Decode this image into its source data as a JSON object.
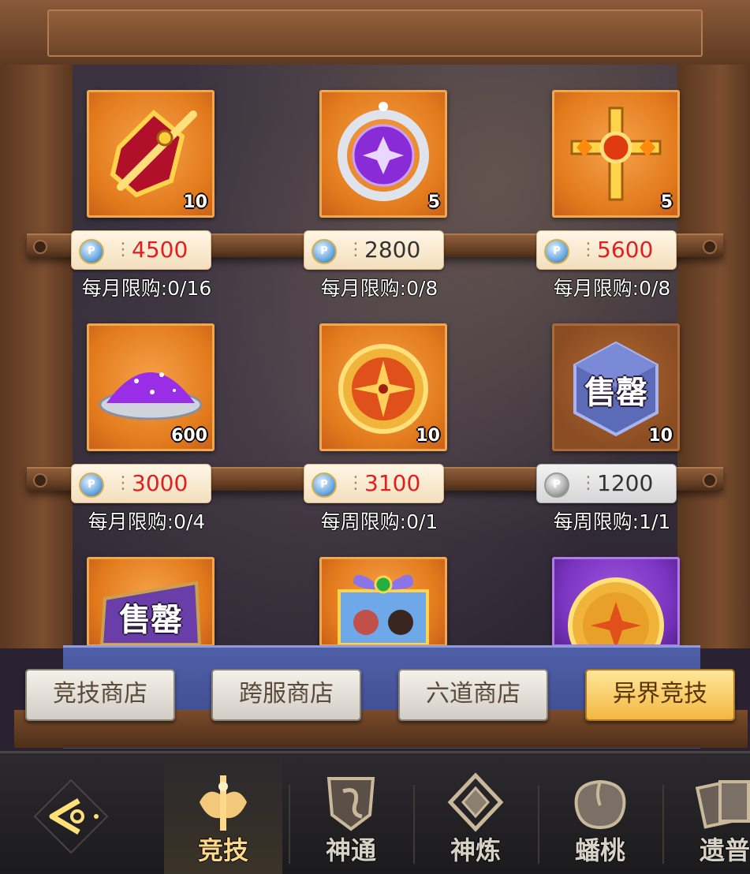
{
  "shop_items": [
    {
      "count": "10",
      "price": "4500",
      "limit": "每月限购:0/16",
      "price_style": "red",
      "box": "orange",
      "icon": "sword-shard-icon"
    },
    {
      "count": "5",
      "price": "2800",
      "limit": "每月限购:0/8",
      "price_style": "dark",
      "box": "orange",
      "icon": "purple-orb-icon"
    },
    {
      "count": "5",
      "price": "5600",
      "limit": "每月限购:0/8",
      "price_style": "red",
      "box": "orange",
      "icon": "golden-cross-icon"
    },
    {
      "count": "600",
      "price": "3000",
      "limit": "每月限购:0/4",
      "price_style": "red",
      "box": "orange",
      "icon": "purple-dust-icon"
    },
    {
      "count": "10",
      "price": "3100",
      "limit": "每周限购:0/1",
      "price_style": "red",
      "box": "orange",
      "icon": "compass-icon"
    },
    {
      "count": "10",
      "price": "1200",
      "limit": "每周限购:1/1",
      "price_style": "dark",
      "box": "dark",
      "sold_out": "售罄",
      "coin": "grey",
      "icon": "cube-icon"
    }
  ],
  "partial_items": [
    {
      "box": "orange",
      "sold_out": "售罄",
      "icon": "scroll-icon"
    },
    {
      "box": "orange",
      "icon": "gift-box-icon"
    },
    {
      "box": "purple",
      "icon": "gold-coin-icon"
    }
  ],
  "currency_symbol": "P",
  "shop_tabs": [
    "竞技商店",
    "跨服商店",
    "六道商店",
    "异界竞技"
  ],
  "active_tab": "异界竞技",
  "nav": {
    "items": [
      "竞技",
      "神通",
      "神炼",
      "蟠桃",
      "遗普"
    ],
    "active": "竞技"
  },
  "colors": {
    "accent": "#f3b742",
    "price_red": "#e02020",
    "banner": "#4f5fa8"
  }
}
